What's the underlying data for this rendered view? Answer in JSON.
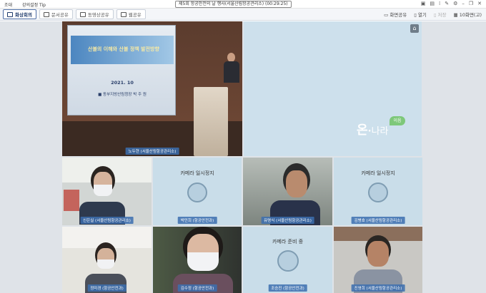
{
  "menu": {
    "exit": "조대",
    "lecture_tip": "강의설정 Tip"
  },
  "window_title": "제5회 항공안전의 날 행사(서울산림항공관리소) (00:29:25)",
  "tabs": [
    {
      "label": "화상회의",
      "active": true
    },
    {
      "label": "문서공유",
      "active": false
    },
    {
      "label": "동영상공유",
      "active": false
    },
    {
      "label": "웹공유",
      "active": false
    }
  ],
  "right_tools": {
    "screen_share": "화면공유",
    "open": "열기",
    "save": "저장",
    "participants": "10화면(고)"
  },
  "presentation": {
    "slide_title": "산불의 이해와 산불 정책 발전방향",
    "slide_date": "2021. 10",
    "slide_presenter": "■ 동부지방산림청장  박 주 원"
  },
  "brand": {
    "on": "온",
    "dot": "·",
    "nara": "나라",
    "ei": "이음"
  },
  "participants": [
    {
      "name": "노두현 (서울산림항공관리소)",
      "status": "video"
    },
    {
      "name": "신은실 (서울산림항공관리소)",
      "status": "video"
    },
    {
      "name": "박민희 (항공안전과)",
      "status": "paused",
      "status_text": "카메라 일시정지"
    },
    {
      "name": "유명식 (서울산림항공관리소)",
      "status": "video"
    },
    {
      "name": "김병호 (서울산림항공관리소)",
      "status": "paused",
      "status_text": "카메라 일시정지"
    },
    {
      "name": "정미경 (항공안전과)",
      "status": "video"
    },
    {
      "name": "김수정 (항공안전과)",
      "status": "video"
    },
    {
      "name": "조승진 (항공안전과)",
      "status": "preparing",
      "status_text": "카메라 준비 중"
    },
    {
      "name": "진영희 (서울산림항공관리소)",
      "status": "video"
    }
  ],
  "colors": {
    "accent": "#3c6eaf",
    "brand_green": "#7ec87a",
    "tile_bg": "#c9dde9"
  }
}
